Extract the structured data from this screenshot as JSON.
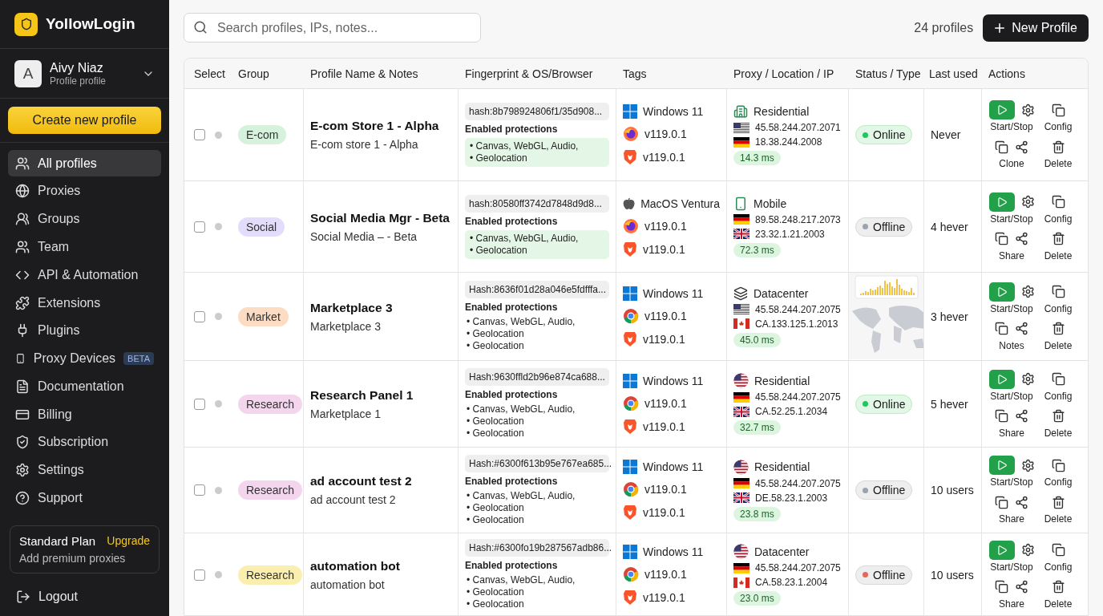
{
  "brand": {
    "name": "YollowLogin"
  },
  "account": {
    "initial": "A",
    "name": "Aivy Niaz",
    "subtitle": "Profile profile"
  },
  "create_button": "Create new profile",
  "sidebar": {
    "items": [
      {
        "label": "All profiles",
        "selected": true
      },
      {
        "label": "Proxies",
        "selected": false
      },
      {
        "label": "Groups",
        "selected": false
      },
      {
        "label": "Team",
        "selected": false
      },
      {
        "label": "API & Automation",
        "selected": false
      },
      {
        "label": "Extensions",
        "selected": false
      },
      {
        "label": "Plugins",
        "selected": false
      },
      {
        "label": "Proxy Devices",
        "selected": false,
        "badge": "BETA"
      },
      {
        "label": "Documentation",
        "selected": false
      },
      {
        "label": "Billing",
        "selected": false
      },
      {
        "label": "Subscription",
        "selected": false
      },
      {
        "label": "Settings",
        "selected": false
      },
      {
        "label": "Support",
        "selected": false
      }
    ]
  },
  "plan": {
    "name": "Standard Plan",
    "link": "Upgrade",
    "note": "Add premium proxies"
  },
  "logout": "Logout",
  "search": {
    "placeholder": "Search profiles, IPs, notes..."
  },
  "count": "24 profiles",
  "new_button": "New Profile",
  "table": {
    "columns": [
      "Select",
      "Group",
      "Profile Name & Notes",
      "Fingerprint & OS/Browser",
      "Tags",
      "Proxy / Location / IP",
      "Status / Type",
      "Last used",
      "Actions"
    ],
    "rows": [
      {
        "selected": false,
        "group": {
          "label": "E-com",
          "color": "#d6f2dc"
        },
        "name": "E-com Store 1 - Alpha",
        "note": "E-com store 1 - Alpha",
        "hash": "hash:8b798924806f1/35d908...",
        "protections_title": "Enabled protections",
        "protections_highlighted": true,
        "protections": [
          "• Canvas, WebGL, Audio,",
          "• Geolocation"
        ],
        "os": {
          "kind": "windows",
          "label": "Windows 11"
        },
        "browsers": [
          {
            "kind": "firefox",
            "version": "v119.0.1"
          },
          {
            "kind": "brave",
            "version": "v119.0.1"
          }
        ],
        "proxy": {
          "kind": "building",
          "type": "Residential",
          "ips": [
            {
              "kind": "us",
              "ip": "45.58.244.207.2071"
            },
            {
              "kind": "de",
              "ip": "18.38.244.2008"
            }
          ],
          "latency": "14.3 ms"
        },
        "status": {
          "kind": "pill",
          "label": "Online",
          "color": "#22c55e"
        },
        "last_used": "Never",
        "actions": [
          "Start/Stop",
          "Config",
          "Clone",
          "Delete"
        ]
      },
      {
        "selected": false,
        "group": {
          "label": "Social",
          "color": "#e4dcfb"
        },
        "name": "Social Media Mgr - Beta",
        "note": "Social Media – - Beta",
        "hash": "hash:80580ff3742d7848d9d8...",
        "protections_title": "Enabled protections",
        "protections_highlighted": true,
        "protections": [
          "• Canvas, WebGL, Audio,",
          "• Geolocation"
        ],
        "os": {
          "kind": "mac",
          "label": "MacOS Ventura"
        },
        "browsers": [
          {
            "kind": "firefox",
            "version": "v119.0.1"
          },
          {
            "kind": "brave",
            "version": "v119.0.1"
          }
        ],
        "proxy": {
          "kind": "phone",
          "type": "Mobile",
          "ips": [
            {
              "kind": "de",
              "ip": "89.58.248.217.2073"
            },
            {
              "kind": "gb",
              "ip": "23.32.1.21.2003"
            }
          ],
          "latency": "72.3 ms"
        },
        "status": {
          "kind": "pill",
          "label": "Offline",
          "color": "#9ca3af"
        },
        "last_used": "4 hever",
        "actions": [
          "Start/Stop",
          "Config",
          "Share",
          "Delete"
        ]
      },
      {
        "selected": false,
        "group": {
          "label": "Market",
          "color": "#fddcc4"
        },
        "name": "Marketplace 3",
        "note": "Marketplace 3",
        "hash": "Hash:8636f01d28a046e5fdfffa...",
        "protections_title": "Enabled protections",
        "protections_highlighted": false,
        "protections": [
          "• Canvas, WebGL, Audio,",
          "• Geolocation",
          "• Geolocation"
        ],
        "os": {
          "kind": "windows",
          "label": "Windows 11"
        },
        "browsers": [
          {
            "kind": "chrome",
            "version": "v119.0.1"
          },
          {
            "kind": "brave",
            "version": "v119.0.1"
          }
        ],
        "proxy": {
          "kind": "stack",
          "type": "Datacenter",
          "ips": [
            {
              "kind": "us",
              "ip": "45.58.244.207.2075"
            },
            {
              "kind": "ca",
              "ip": "CA.133.125.1.2013"
            }
          ],
          "latency": "45.0 ms"
        },
        "status": {
          "kind": "picture"
        },
        "last_used": "3 hever",
        "actions": [
          "Start/Stop",
          "Config",
          "Notes",
          "Delete"
        ]
      },
      {
        "selected": false,
        "group": {
          "label": "Research",
          "color": "#f3d6ee"
        },
        "name": "Research Panel 1",
        "note": "Marketplace 1",
        "hash": "Hash:9630ffld2b96e874ca688...",
        "protections_title": "Enabled protections",
        "protections_highlighted": false,
        "protections": [
          "• Canvas, WebGL, Audio,",
          "• Geolocation",
          "• Geolocation"
        ],
        "os": {
          "kind": "windows",
          "label": "Windows 11"
        },
        "browsers": [
          {
            "kind": "chrome",
            "version": "v119.0.1"
          },
          {
            "kind": "brave",
            "version": "v119.0.1"
          }
        ],
        "proxy": {
          "kind": "usflag",
          "type": "Residential",
          "ips": [
            {
              "kind": "de",
              "ip": "45.58.244.207.2075"
            },
            {
              "kind": "gb",
              "ip": "CA.52.25.1.2034"
            }
          ],
          "latency": "32.7 ms"
        },
        "status": {
          "kind": "pill",
          "label": "Online",
          "color": "#22c55e"
        },
        "last_used": "5 hever",
        "actions": [
          "Start/Stop",
          "Config",
          "Share",
          "Delete"
        ]
      },
      {
        "selected": false,
        "group": {
          "label": "Research",
          "color": "#f3d6ee"
        },
        "name": "ad account test 2",
        "note": "ad account test 2",
        "hash": "Hash:#6300f613b95e767ea685...",
        "protections_title": "Enabled protections",
        "protections_highlighted": false,
        "protections": [
          "• Canvas, WebGL, Audio,",
          "• Geolocation",
          "• Geolocation"
        ],
        "os": {
          "kind": "windows",
          "label": "Windows 11"
        },
        "browsers": [
          {
            "kind": "chrome",
            "version": "v119.0.1"
          },
          {
            "kind": "brave",
            "version": "v119.0.1"
          }
        ],
        "proxy": {
          "kind": "usflag",
          "type": "Residential",
          "ips": [
            {
              "kind": "de",
              "ip": "45.58.244.207.2075"
            },
            {
              "kind": "gb",
              "ip": "DE.58.23.1.2003"
            }
          ],
          "latency": "23.8 ms"
        },
        "status": {
          "kind": "pill",
          "label": "Offline",
          "color": "#9ca3af"
        },
        "last_used": "10 users",
        "actions": [
          "Start/Stop",
          "Config",
          "Share",
          "Delete"
        ]
      },
      {
        "selected": false,
        "group": {
          "label": "Research",
          "color": "#fbefb0"
        },
        "name": "automation bot",
        "note": "automation bot",
        "hash": "Hash:#6300fo19b287567adb86...",
        "protections_title": "Enabled protections",
        "protections_highlighted": false,
        "protections": [
          "• Canvas, WebGL, Audio,",
          "• Geolocation",
          "• Geolocation"
        ],
        "os": {
          "kind": "windows",
          "label": "Windows 11"
        },
        "browsers": [
          {
            "kind": "chrome",
            "version": "v119.0.1"
          },
          {
            "kind": "brave",
            "version": "v119.0.1"
          }
        ],
        "proxy": {
          "kind": "usflag",
          "type": "Datacenter",
          "ips": [
            {
              "kind": "de",
              "ip": "45.58.244.207.2075"
            },
            {
              "kind": "ca",
              "ip": "CA.58.23.1.2004"
            }
          ],
          "latency": "23.0 ms"
        },
        "status": {
          "kind": "pill",
          "label": "Offline",
          "color": "#e5675a"
        },
        "last_used": "10 users",
        "actions": [
          "Start/Stop",
          "Config",
          "Share",
          "Delete"
        ]
      }
    ]
  }
}
